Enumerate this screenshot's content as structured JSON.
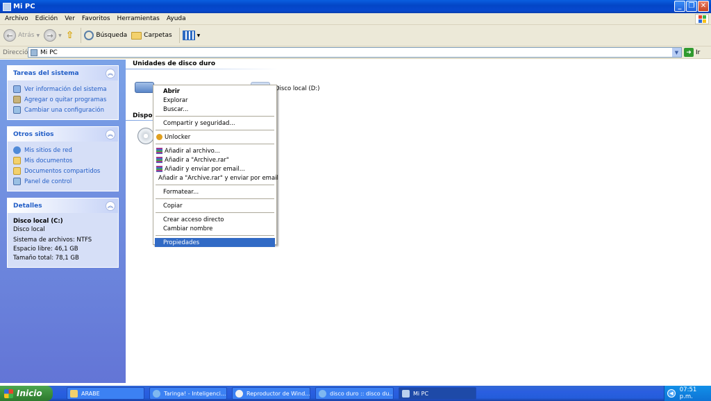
{
  "window": {
    "title": "Mi PC"
  },
  "menubar": {
    "items": [
      "Archivo",
      "Edición",
      "Ver",
      "Favoritos",
      "Herramientas",
      "Ayuda"
    ]
  },
  "toolbar": {
    "back": "Atrás",
    "search": "Búsqueda",
    "folders": "Carpetas"
  },
  "address": {
    "label": "Dirección",
    "value": "Mi PC",
    "go": "Ir"
  },
  "sidebar": {
    "system_tasks": {
      "title": "Tareas del sistema",
      "items": [
        "Ver información del sistema",
        "Agregar o quitar programas",
        "Cambiar una configuración"
      ]
    },
    "other_places": {
      "title": "Otros sitios",
      "items": [
        "Mis sitios de red",
        "Mis documentos",
        "Documentos compartidos",
        "Panel de control"
      ]
    },
    "details": {
      "title": "Detalles",
      "name": "Disco local (C:)",
      "type": "Disco local",
      "filesystem": "Sistema de archivos: NTFS",
      "free": "Espacio libre: 46,1 GB",
      "total": "Tamaño total: 78,1 GB"
    }
  },
  "content": {
    "hard_drives_title": "Unidades de disco duro",
    "removable_title": "Dispos",
    "drive_d_label": "Disco local (D:)"
  },
  "context_menu": {
    "open": "Abrir",
    "explore": "Explorar",
    "search": "Buscar...",
    "share": "Compartir y seguridad...",
    "unlocker": "Unlocker",
    "add_archive": "Añadir al archivo...",
    "add_rar": "Añadir a \"Archive.rar\"",
    "add_email": "Añadir y enviar por email...",
    "add_rar_email": "Añadir a \"Archive.rar\" y enviar por email",
    "format": "Formatear...",
    "copy": "Copiar",
    "shortcut": "Crear acceso directo",
    "rename": "Cambiar nombre",
    "properties": "Propiedades"
  },
  "taskbar": {
    "start": "Inicio",
    "items": [
      "ARABE",
      "Taringa! - Inteligenci...",
      "Reproductor de Wind...",
      "disco duro :: disco du...",
      "Mi PC"
    ],
    "clock": "07:51 p.m."
  },
  "colors": {
    "selection": "#316ac5",
    "title_blue": "#0346c6",
    "task_blue": "#215dc6"
  }
}
